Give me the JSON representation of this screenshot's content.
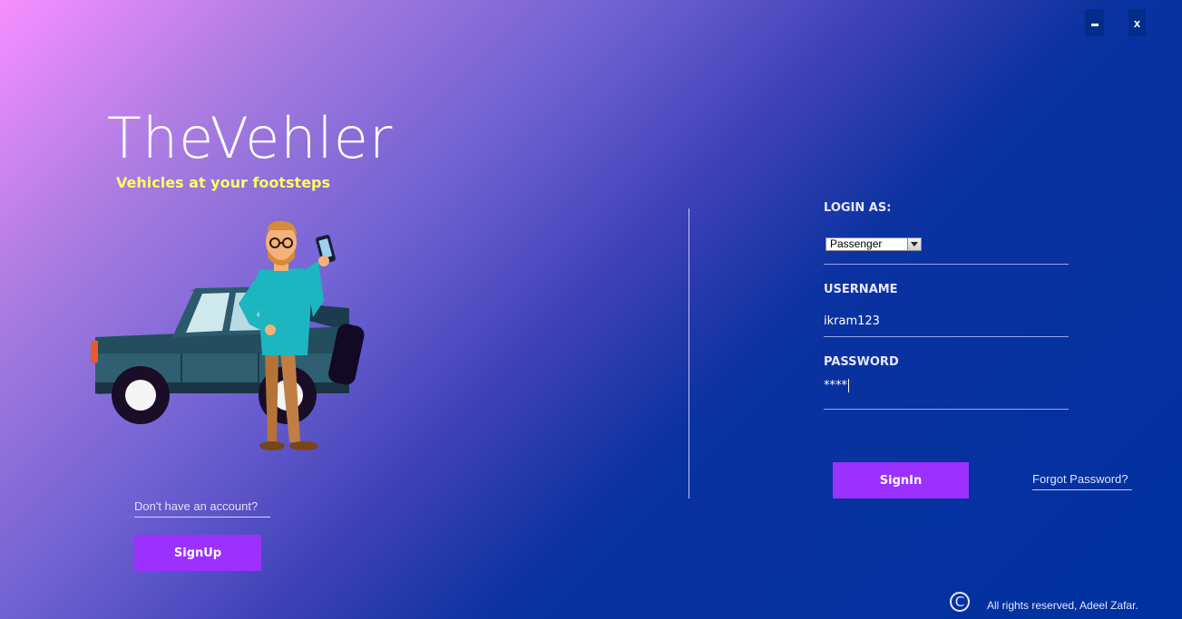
{
  "window": {
    "minimize_label": "",
    "close_label": "x"
  },
  "brand": {
    "title": "TheVehler",
    "tagline": "Vehicles at your footsteps"
  },
  "signup": {
    "prompt": "Don't have an account?",
    "button_label": "SignUp"
  },
  "login": {
    "login_as_label": "LOGIN AS:",
    "role_options": [
      "Passenger"
    ],
    "role_selected": "Passenger",
    "username_label": "USERNAME",
    "username_value": "ikram123",
    "password_label": "PASSWORD",
    "password_masked": "****",
    "signin_label": "SignIn",
    "forgot_label": "Forgot Password?"
  },
  "footer": {
    "copyright_symbol": "C",
    "text": "All rights reserved, Adeel Zafar."
  },
  "colors": {
    "accent_button": "#9b30ff",
    "tagline": "#ffff66",
    "window_button": "#002d8a"
  }
}
